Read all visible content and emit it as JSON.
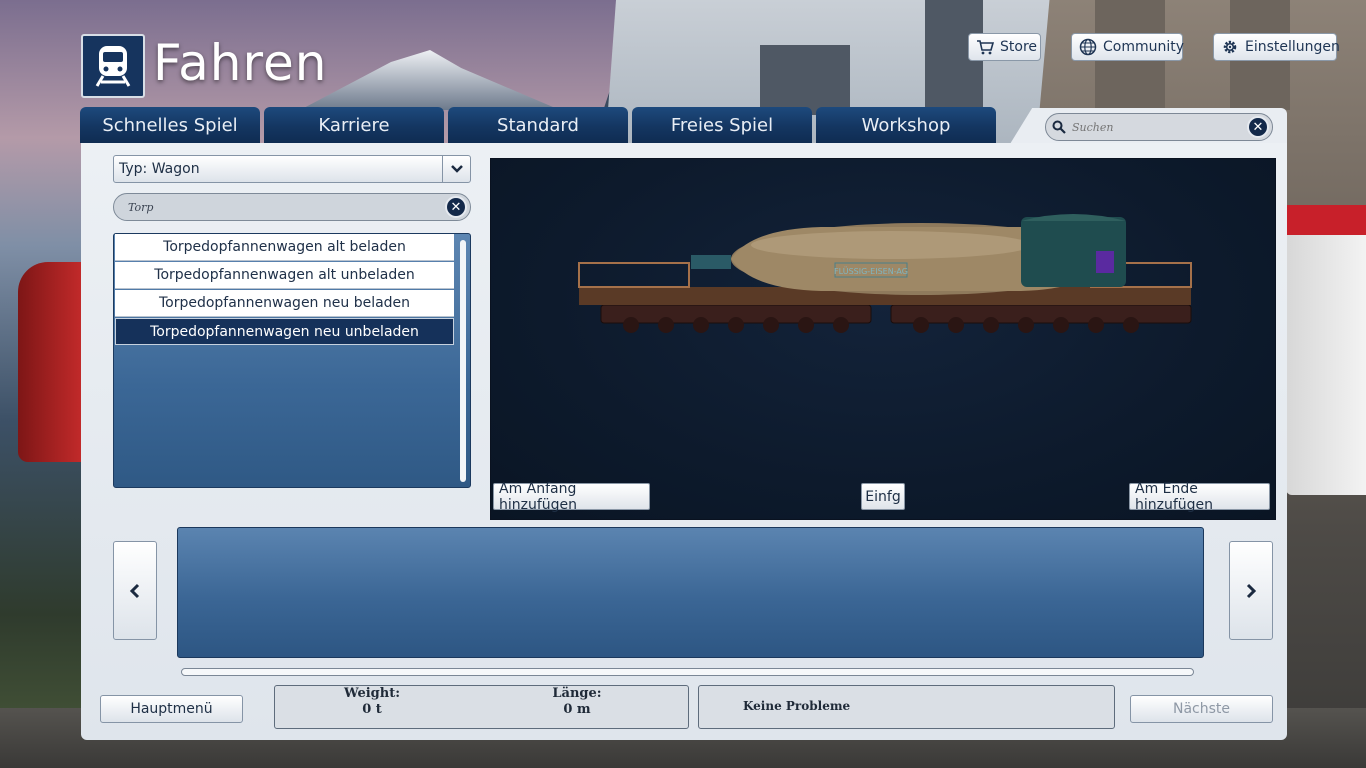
{
  "header": {
    "title": "Fahren",
    "logo_icon": "train-icon"
  },
  "top_buttons": {
    "store": "Store",
    "community": "Community",
    "settings": "Einstellungen"
  },
  "tabs": [
    {
      "label": "Schnelles Spiel"
    },
    {
      "label": "Karriere"
    },
    {
      "label": "Standard"
    },
    {
      "label": "Freies Spiel"
    },
    {
      "label": "Workshop"
    }
  ],
  "top_search": {
    "placeholder": "Suchen",
    "value": ""
  },
  "filter": {
    "type_value": "Typ: Wagon",
    "search_value": "Torp"
  },
  "wagon_list": {
    "items": [
      {
        "label": "Torpedopfannenwagen alt beladen",
        "selected": false
      },
      {
        "label": "Torpedopfannenwagen alt unbeladen",
        "selected": false
      },
      {
        "label": "Torpedopfannenwagen neu beladen",
        "selected": false
      },
      {
        "label": "Torpedopfannenwagen neu unbeladen",
        "selected": true
      }
    ]
  },
  "preview": {
    "wagon_marking": "FLÜSSIG-EISEN-AG",
    "add_start": "Am Anfang hinzufügen",
    "insert": "Einfg",
    "add_end": "Am Ende hinzufügen"
  },
  "footer": {
    "main_menu": "Hauptmenü",
    "weight_label": "Weight:",
    "weight_value": "0 t",
    "length_label": "Länge:",
    "length_value": "0 m",
    "status": "Keine Probleme",
    "next": "Nächste"
  },
  "colors": {
    "tab_bg": "#143661",
    "panel_bg": "#e6ebf0",
    "list_selected": "#15315a",
    "preview_bg": "#0d1a2c"
  }
}
